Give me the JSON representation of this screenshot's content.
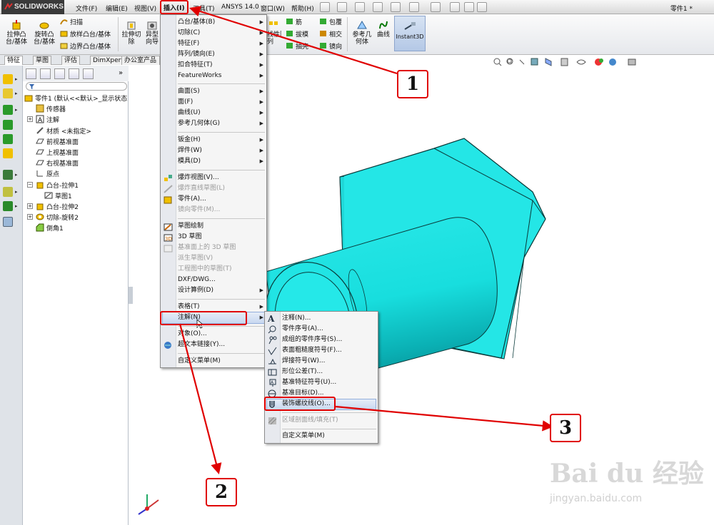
{
  "menubar": {
    "logo": "SOLIDWORKS",
    "items": [
      "文件(F)",
      "编辑(E)",
      "视图(V)",
      "插入(I)",
      "工具(T)",
      "ANSYS 14.0",
      "窗口(W)",
      "帮助(H)"
    ],
    "doc_title": "零件1 *"
  },
  "ribbon": {
    "extrude_boss": "拉伸凸\n台/基体",
    "revolve_boss": "旋转凸\n台/基体",
    "sweep": "扫描",
    "loft": "放样凸台/基体",
    "boundary": "边界凸台/基体",
    "extrude_cut": "拉伸切\n除",
    "hole_wizard": "异型\n向导",
    "linear_pattern": "线性阵\n列",
    "rib": "筋",
    "draft": "拔模",
    "wrap": "包覆",
    "intersect": "相交",
    "shell": "抽壳",
    "mirror": "镜向",
    "ref_geom": "参考几\n何体",
    "curves": "曲线",
    "instant3d": "Instant3D"
  },
  "tabs": [
    "特征",
    "草图",
    "评估",
    "DimXpert",
    "办公室产品"
  ],
  "tree": {
    "root": "零件1 (默认<<默认>_显示状态",
    "items": [
      "传感器",
      "注解",
      "材质 <未指定>",
      "前视基准面",
      "上视基准面",
      "右视基准面",
      "原点",
      "凸台-拉伸1",
      "草图1",
      "凸台-拉伸2",
      "切除-旋转2",
      "倒角1"
    ]
  },
  "insert_menu": {
    "items": [
      {
        "label": "凸台/基体(B)",
        "sub": true
      },
      {
        "label": "切除(C)",
        "sub": true
      },
      {
        "label": "特征(F)",
        "sub": true
      },
      {
        "label": "阵列/镜向(E)",
        "sub": true
      },
      {
        "label": "扣合特征(T)",
        "sub": true
      },
      {
        "label": "FeatureWorks",
        "sub": true
      },
      {
        "label": "曲面(S)",
        "sub": true
      },
      {
        "label": "面(F)",
        "sub": true
      },
      {
        "label": "曲线(U)",
        "sub": true
      },
      {
        "label": "参考几何体(G)",
        "sub": true
      },
      {
        "label": "钣金(H)",
        "sub": true
      },
      {
        "label": "焊件(W)",
        "sub": true
      },
      {
        "label": "模具(D)",
        "sub": true
      },
      {
        "label": "爆炸视图(V)...",
        "sub": false
      },
      {
        "label": "爆炸直线草图(L)",
        "sub": false,
        "disabled": true
      },
      {
        "label": "零件(A)...",
        "sub": false
      },
      {
        "label": "镜向零件(M)...",
        "sub": false,
        "disabled": true
      },
      {
        "label": "草图绘制",
        "sub": false
      },
      {
        "label": "3D 草图",
        "sub": false
      },
      {
        "label": "基准面上的 3D 草图",
        "sub": false,
        "disabled": true
      },
      {
        "label": "派生草图(V)",
        "sub": false,
        "disabled": true
      },
      {
        "label": "工程图中的草图(T)",
        "sub": false,
        "disabled": true
      },
      {
        "label": "DXF/DWG...",
        "sub": false
      },
      {
        "label": "设计算例(D)",
        "sub": true
      },
      {
        "label": "表格(T)",
        "sub": true
      },
      {
        "label": "注解(N)",
        "sub": true
      },
      {
        "label": "对象(O)...",
        "sub": false
      },
      {
        "label": "超文本链接(Y)...",
        "sub": false
      },
      {
        "label": "自定义菜单(M)",
        "sub": false
      }
    ]
  },
  "annot_menu": {
    "items": [
      {
        "label": "注释(N)...",
        "disabled": false
      },
      {
        "label": "零件序号(A)...",
        "disabled": false
      },
      {
        "label": "成组的零件序号(S)...",
        "disabled": false
      },
      {
        "label": "表面粗糙度符号(F)...",
        "disabled": false
      },
      {
        "label": "焊接符号(W)...",
        "disabled": false
      },
      {
        "label": "形位公差(T)...",
        "disabled": false
      },
      {
        "label": "基准特征符号(U)...",
        "disabled": false
      },
      {
        "label": "基准目标(D)...",
        "disabled": false
      },
      {
        "label": "装饰螺纹线(O)...",
        "disabled": false
      },
      {
        "label": "区域剖面线/填充(T)",
        "disabled": true
      },
      {
        "label": "自定义菜单(M)",
        "disabled": false
      }
    ]
  },
  "callouts": [
    "1",
    "2",
    "3"
  ],
  "watermark": {
    "main": "Bai du 经验",
    "url": "jingyan.baidu.com"
  },
  "colors": {
    "part": "#22e6e6",
    "callout": "#e00000",
    "highlight": "#c8d8f0"
  }
}
